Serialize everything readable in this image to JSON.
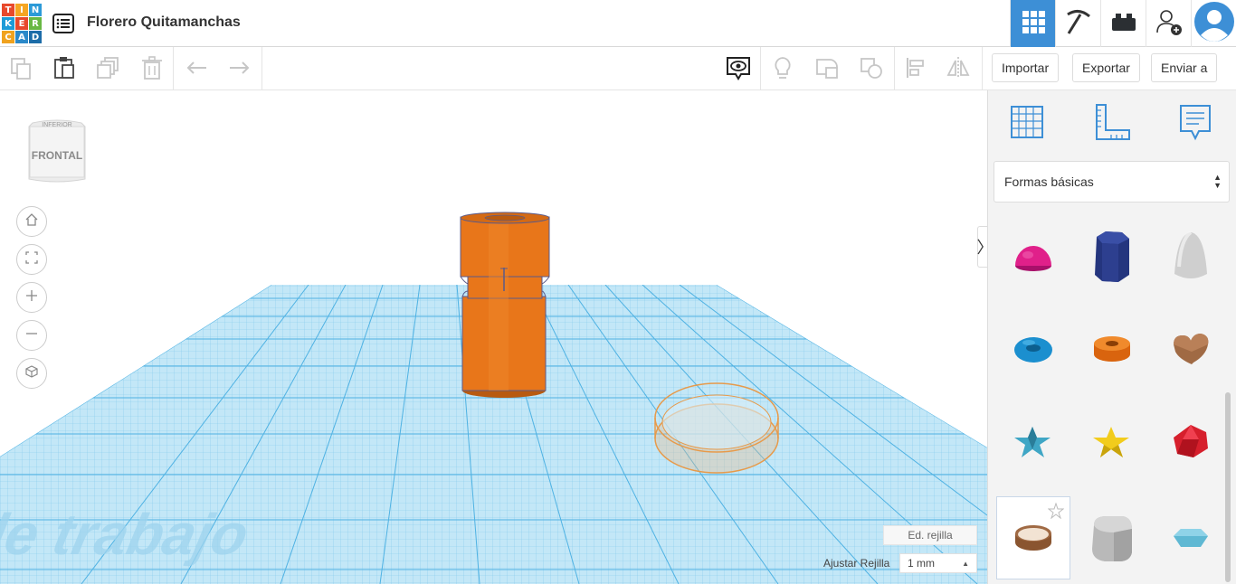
{
  "app": {
    "logo_letters": [
      "T",
      "I",
      "N",
      "K",
      "E",
      "R",
      "C",
      "A",
      "D"
    ],
    "title": "Florero Quitamanchas"
  },
  "header": {
    "buttons": [
      {
        "name": "3d-design-view-button",
        "icon": "grid-icon",
        "active": true
      },
      {
        "name": "codeblocks-view-button",
        "icon": "pickaxe-icon",
        "active": false
      },
      {
        "name": "bricks-view-button",
        "icon": "brick-icon",
        "active": false
      },
      {
        "name": "invite-user-button",
        "icon": "add-user-icon",
        "active": false
      },
      {
        "name": "profile-avatar",
        "icon": "avatar-icon",
        "active": false
      }
    ]
  },
  "toolbar": {
    "import_label": "Importar",
    "export_label": "Exportar",
    "send_label": "Enviar a"
  },
  "viewcube": {
    "face_label": "FRONTAL",
    "top_label": "INFERIOR"
  },
  "workplane": {
    "watermark": "Plano de trabajo",
    "edit_grid_label": "Ed. rejilla",
    "snap_grid_label": "Ajustar Rejilla",
    "snap_grid_value": "1 mm"
  },
  "panel": {
    "category": "Formas básicas",
    "shapes": [
      {
        "name": "half-sphere",
        "color": "#e0208a"
      },
      {
        "name": "polygon",
        "color": "#2d3f8f"
      },
      {
        "name": "paraboloid",
        "color": "#cfcfcf"
      },
      {
        "name": "torus",
        "color": "#1b8fcf"
      },
      {
        "name": "tube",
        "color": "#f07a1a"
      },
      {
        "name": "heart",
        "color": "#a06a44"
      },
      {
        "name": "star",
        "color": "#3fa6c5"
      },
      {
        "name": "star-yellow",
        "color": "#f2cc1c"
      },
      {
        "name": "icosahedron",
        "color": "#d61f2c"
      },
      {
        "name": "ring",
        "color": "#a06a44"
      },
      {
        "name": "round-roof",
        "color": "#b9b9b9"
      },
      {
        "name": "diamond",
        "color": "#5fb8d3"
      }
    ]
  },
  "colors": {
    "accent": "#3d8fd6",
    "object_orange": "#e8761a",
    "grid_blue": "#8fd0ef"
  }
}
